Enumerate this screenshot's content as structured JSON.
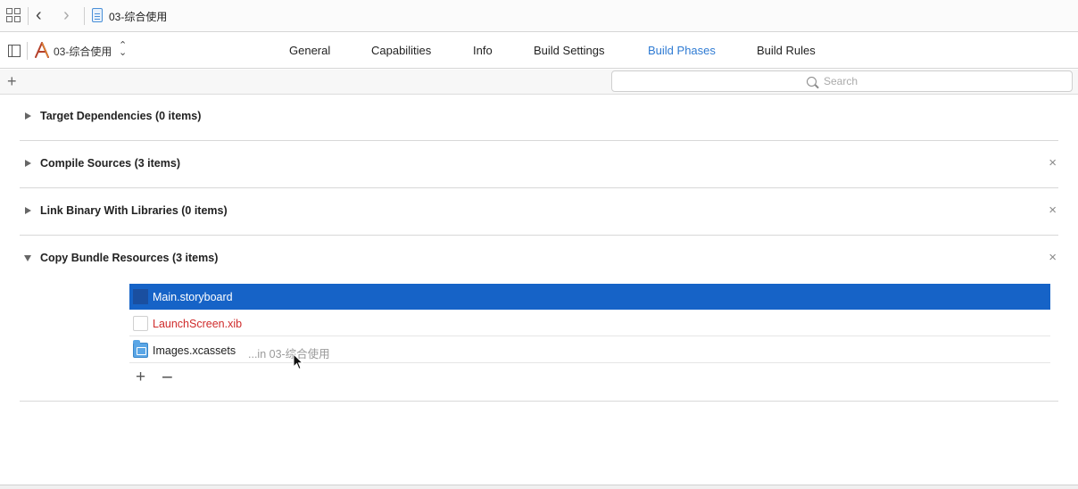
{
  "jumpbar": {
    "file_name": "03-综合使用",
    "icons": [
      "related-items-icon",
      "back-arrow-icon",
      "forward-arrow-icon",
      "file-icon"
    ]
  },
  "tabbar": {
    "target_label": "03-综合使用",
    "target_chevron": "⌃⌄",
    "tabs": [
      {
        "label": "General",
        "active": false
      },
      {
        "label": "Capabilities",
        "active": false
      },
      {
        "label": "Info",
        "active": false
      },
      {
        "label": "Build Settings",
        "active": false
      },
      {
        "label": "Build Phases",
        "active": true
      },
      {
        "label": "Build Rules",
        "active": false
      }
    ],
    "accent_color": "#2f7bd3"
  },
  "filterbar": {
    "add_label": "+",
    "search_placeholder": "Search",
    "search_value": ""
  },
  "phases": [
    {
      "title": "Target Dependencies (0 items)",
      "expanded": false,
      "removable": false
    },
    {
      "title": "Compile Sources (3 items)",
      "expanded": false,
      "removable": true
    },
    {
      "title": "Link Binary With Libraries (0 items)",
      "expanded": false,
      "removable": true
    },
    {
      "title": "Copy Bundle Resources (3 items)",
      "expanded": true,
      "removable": true
    }
  ],
  "close_glyph": "×",
  "resources": [
    {
      "name": "Main.storyboard",
      "location": "",
      "selected": true,
      "missing": false,
      "icon": "storyboard-icon"
    },
    {
      "name": "LaunchScreen.xib",
      "location": "",
      "selected": false,
      "missing": true,
      "icon": "xib-file-icon"
    },
    {
      "name": "Images.xcassets",
      "location": "...in 03-综合使用",
      "selected": false,
      "missing": false,
      "icon": "asset-catalog-icon"
    }
  ],
  "list_controls": {
    "add": "+",
    "remove": "−"
  },
  "colors": {
    "selection": "#1663c7",
    "missing_text": "#cf2b2b"
  }
}
